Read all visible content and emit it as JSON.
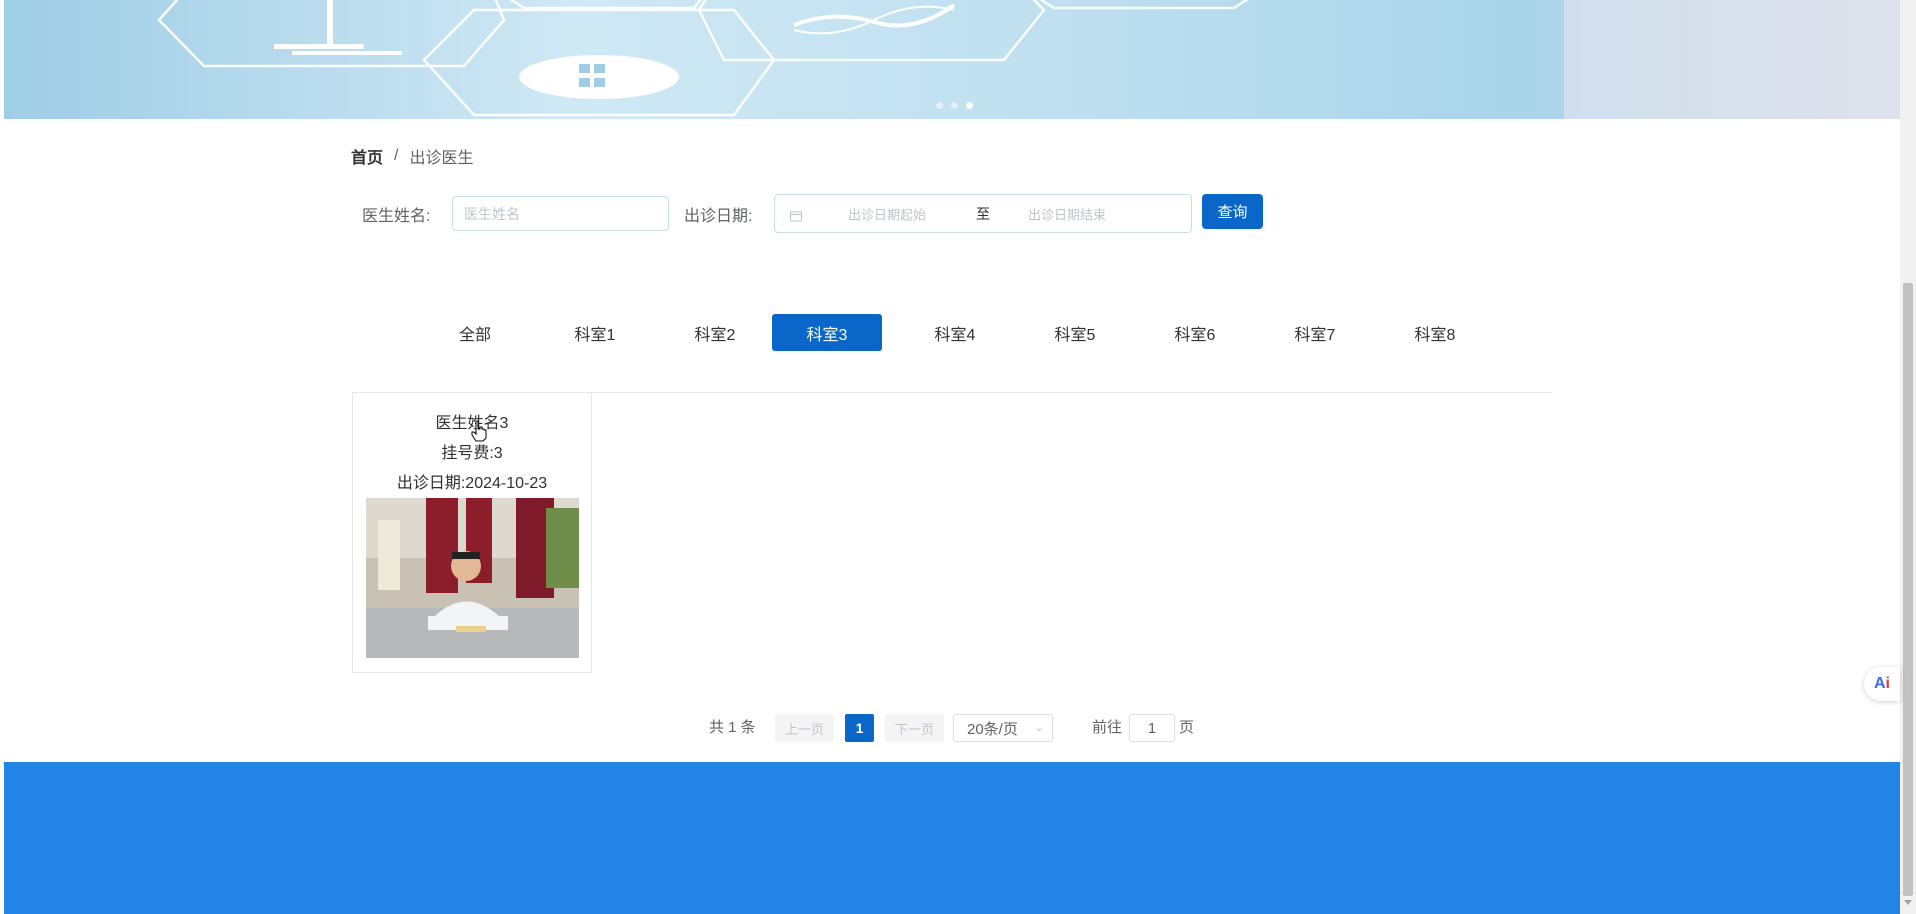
{
  "banner": {
    "carousel_dots": 3,
    "active_dot": 3
  },
  "breadcrumb": {
    "home": "首页",
    "separator": "/",
    "current": "出诊医生"
  },
  "search": {
    "doctor_name_label": "医生姓名:",
    "doctor_name_placeholder": "医生姓名",
    "date_label": "出诊日期:",
    "date_start_placeholder": "出诊日期起始",
    "date_to": "至",
    "date_end_placeholder": "出诊日期结束",
    "query_button": "查询"
  },
  "departments": {
    "tabs": [
      "全部",
      "科室1",
      "科室2",
      "科室3",
      "科室4",
      "科室5",
      "科室6",
      "科室7",
      "科室8"
    ],
    "active": "科室3"
  },
  "doctors": [
    {
      "name": "医生姓名3",
      "fee": "挂号费:3",
      "date": "出诊日期:2024-10-23",
      "photo": "doctor-photo"
    }
  ],
  "pagination": {
    "total": "共 1 条",
    "prev": "上一页",
    "current_page": "1",
    "next": "下一页",
    "page_size": "20条/页",
    "goto_label": "前往",
    "goto_value": "1",
    "page_suffix": "页"
  },
  "floating": {
    "ai_label_a": "A",
    "ai_label_i": "i"
  },
  "colors": {
    "primary": "#0a66c8",
    "footer": "#2384e6"
  }
}
